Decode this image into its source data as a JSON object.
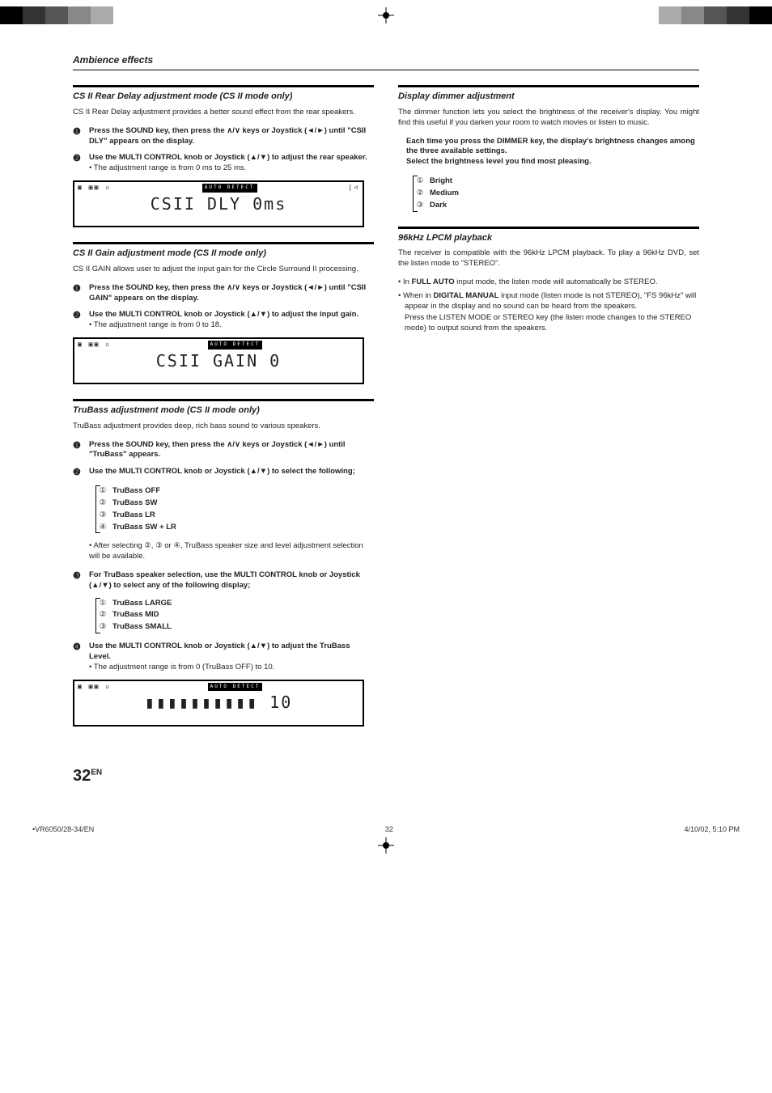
{
  "header": "Ambience effects",
  "left": {
    "sec1": {
      "title": "CS II Rear Delay adjustment mode (CS II mode only)",
      "desc": "CS II Rear Delay adjustment provides a better sound effect from the rear speakers.",
      "step1": "Press the SOUND key, then press the ∧/∨ keys or Joystick (◄/►) until \"CSII DLY\" appears on the display.",
      "step2": "Use the MULTI CONTROL knob or Joystick (▲/▼) to adjust the rear speaker.",
      "step2b": "• The adjustment range is from 0 ms to 25 ms.",
      "lcd": "CSII  DLY    0ms"
    },
    "sec2": {
      "title": "CS II Gain adjustment mode (CS II mode only)",
      "desc": "CS II GAIN allows user to adjust the input gain for the Circle Surround II processing.",
      "step1": "Press the SOUND key, then press the ∧/∨ keys or Joystick (◄/►) until \"CSII GAIN\" appears on the display.",
      "step2": "Use the MULTI CONTROL knob or Joystick (▲/▼) to adjust the input gain.",
      "step2b": "• The adjustment range is from 0 to 18.",
      "lcd": "CSII  GAIN    0"
    },
    "sec3": {
      "title": "TruBass adjustment mode (CS II mode only)",
      "desc": "TruBass adjustment provides deep, rich bass sound to various speakers.",
      "step1": "Press the SOUND key, then press the ∧/∨ keys or Joystick (◄/►) until \"TruBass\" appears.",
      "step2": "Use the MULTI CONTROL knob or Joystick (▲/▼) to select the following;",
      "opts1": {
        "o1": "TruBass OFF",
        "o2": "TruBass SW",
        "o3": "TruBass LR",
        "o4": "TruBass SW + LR"
      },
      "note1": "• After selecting ②, ③ or ④, TruBass speaker size and level adjustment selection will be available.",
      "step3": "For TruBass speaker selection, use the MULTI CONTROL knob or Joystick (▲/▼) to select any of the following display;",
      "opts2": {
        "o1": "TruBass LARGE",
        "o2": "TruBass MID",
        "o3": "TruBass SMALL"
      },
      "step4": "Use the MULTI CONTROL knob or Joystick (▲/▼) to adjust the TruBass Level.",
      "step4b": "• The adjustment range is from 0 (TruBass OFF) to 10.",
      "lcd": "▮▮▮▮▮▮▮▮▮▮  10"
    }
  },
  "right": {
    "sec1": {
      "title": "Display dimmer adjustment",
      "desc": "The dimmer function lets you select the brightness of the receiver's display. You might find this useful if you darken your room to watch movies or listen to music.",
      "note": "Each time you press the DIMMER key, the display's brightness changes among the three available settings.\nSelect the brightness level you find most pleasing.",
      "opts": {
        "o1": "Bright",
        "o2": "Medium",
        "o3": "Dark"
      }
    },
    "sec2": {
      "title": "96kHz LPCM playback",
      "desc": "The receiver is compatible with the 96kHz LPCM playback. To play a 96kHz DVD, set the listen mode to \"STEREO\".",
      "b1a": "• In ",
      "b1b": "FULL AUTO",
      "b1c": " input mode, the listen mode will automatically be STEREO.",
      "b2a": "• When in ",
      "b2b": "DIGITAL MANUAL",
      "b2c": " input mode (listen mode is not STEREO), \"FS 96kHz\" will appear in the display and no sound can be heard from the speakers.",
      "b2d": "Press the LISTEN MODE or STEREO key (the listen mode changes to the STEREO mode) to output sound from the speakers."
    }
  },
  "page": {
    "num": "32",
    "lang": "EN"
  },
  "footer": {
    "left": "•VR6050/28-34/EN",
    "mid": "32",
    "right": "4/10/02, 5:10 PM"
  },
  "lcdbadge": "AUTO DETECT"
}
